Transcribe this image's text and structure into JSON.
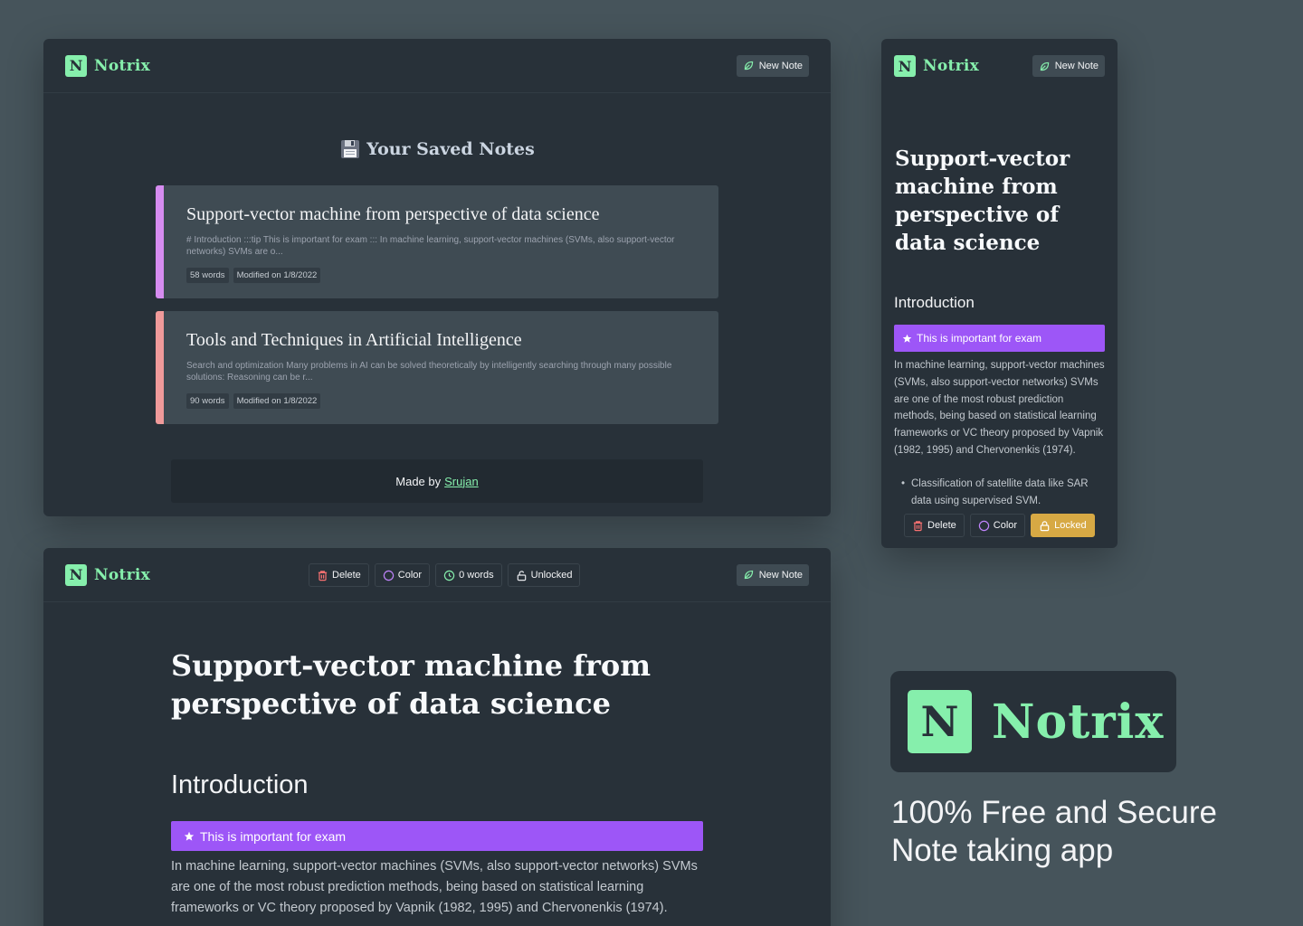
{
  "brand": {
    "logo_letter": "N",
    "name": "Notrix",
    "accent_color": "#86efac"
  },
  "header": {
    "new_note_label": "New Note"
  },
  "saved_notes": {
    "heading": "Your Saved Notes",
    "notes": [
      {
        "title": "Support-vector machine from perspective of data science",
        "snippet": "# Introduction :::tip This is important for exam ::: In machine learning, support-vector machines (SVMs, also support-vector networks) SVMs are o...",
        "words": "58 words",
        "modified": "Modified on 1/8/2022",
        "accent_color": "#d68cf0"
      },
      {
        "title": "Tools and Techniques in Artificial Intelligence",
        "snippet": "Search and optimization Many problems in AI can be solved theoretically by intelligently searching through many possible solutions: Reasoning can be r...",
        "words": "90 words",
        "modified": "Modified on 1/8/2022",
        "accent_color": "#f09a9a"
      }
    ],
    "footer_prefix": "Made by",
    "footer_author": "Srujan"
  },
  "mobile_note": {
    "title": "Support-vector machine from perspective of data science",
    "heading": "Introduction",
    "tip": "This is important for exam",
    "body": "In machine learning, support-vector machines (SVMs, also support-vector networks) SVMs are one of the most robust prediction methods, being based on statistical learning frameworks or VC theory proposed by Vapnik (1982, 1995) and Chervonenkis (1974).",
    "bullet": "Classification of satellite data like SAR data using supervised SVM.",
    "actions": {
      "delete": "Delete",
      "color": "Color",
      "locked": "Locked"
    }
  },
  "editor": {
    "toolbar": {
      "delete": "Delete",
      "color": "Color",
      "words": "0 words",
      "unlocked": "Unlocked"
    },
    "title": "Support-vector machine from perspective of data science",
    "heading": "Introduction",
    "tip": "This is important for exam",
    "body": "In machine learning, support-vector machines (SVMs, also support-vector networks) SVMs are one of the most robust prediction methods, being based on statistical learning frameworks or VC theory proposed by Vapnik (1982, 1995) and Chervonenkis (1974)."
  },
  "promo": {
    "logo_letter": "N",
    "name": "Notrix",
    "tagline_line1": "100% Free and Secure",
    "tagline_line2": "Note taking app"
  },
  "colors": {
    "tip_purple": "#9d56f7",
    "locked_gold": "#d7a944",
    "delete_red": "#f87171",
    "color_purple": "#c084fc",
    "words_green": "#86efac"
  }
}
